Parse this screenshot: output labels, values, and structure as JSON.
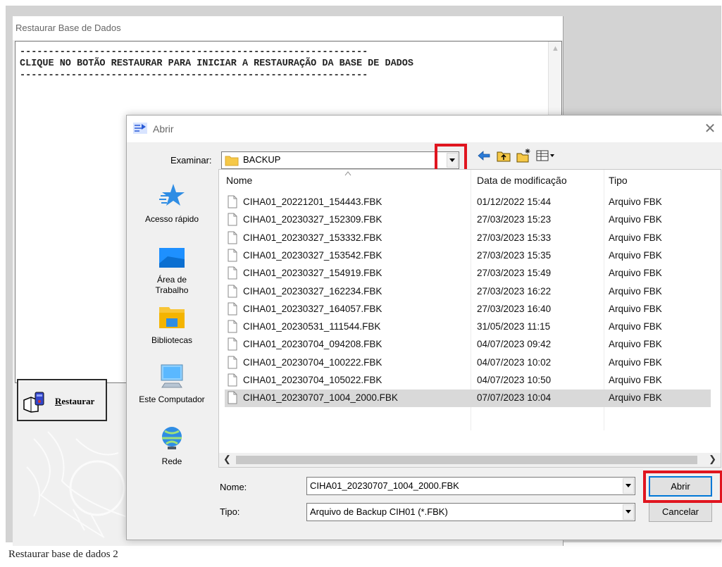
{
  "bg_window": {
    "title": "Restaurar Base de Dados",
    "memo_lines": [
      "-------------------------------------------------------------",
      "CLIQUE NO BOTÃO RESTAURAR PARA INICIAR A RESTAURAÇÃO DA BASE DE DADOS",
      "-------------------------------------------------------------"
    ],
    "restore_button": {
      "label_first": "R",
      "label_rest": "estaurar"
    }
  },
  "dialog": {
    "title": "Abrir",
    "close_glyph": "✕",
    "lookin_label": "Examinar:",
    "lookin_value": "BACKUP",
    "places": [
      {
        "label": "Acesso rápido",
        "icon": "quick-access-star-icon"
      },
      {
        "label": "Área de\nTrabalho",
        "icon": "desktop-icon"
      },
      {
        "label": "Bibliotecas",
        "icon": "libraries-icon"
      },
      {
        "label": "Este Computador",
        "icon": "computer-icon"
      },
      {
        "label": "Rede",
        "icon": "network-icon"
      }
    ],
    "columns": [
      "Nome",
      "Data de modificação",
      "Tipo"
    ],
    "files": [
      {
        "name": "CIHA01_20221201_154443.FBK",
        "date": "01/12/2022 15:44",
        "type": "Arquivo FBK"
      },
      {
        "name": "CIHA01_20230327_152309.FBK",
        "date": "27/03/2023 15:23",
        "type": "Arquivo FBK"
      },
      {
        "name": "CIHA01_20230327_153332.FBK",
        "date": "27/03/2023 15:33",
        "type": "Arquivo FBK"
      },
      {
        "name": "CIHA01_20230327_153542.FBK",
        "date": "27/03/2023 15:35",
        "type": "Arquivo FBK"
      },
      {
        "name": "CIHA01_20230327_154919.FBK",
        "date": "27/03/2023 15:49",
        "type": "Arquivo FBK"
      },
      {
        "name": "CIHA01_20230327_162234.FBK",
        "date": "27/03/2023 16:22",
        "type": "Arquivo FBK"
      },
      {
        "name": "CIHA01_20230327_164057.FBK",
        "date": "27/03/2023 16:40",
        "type": "Arquivo FBK"
      },
      {
        "name": "CIHA01_20230531_111544.FBK",
        "date": "31/05/2023 11:15",
        "type": "Arquivo FBK"
      },
      {
        "name": "CIHA01_20230704_094208.FBK",
        "date": "04/07/2023 09:42",
        "type": "Arquivo FBK"
      },
      {
        "name": "CIHA01_20230704_100222.FBK",
        "date": "04/07/2023 10:02",
        "type": "Arquivo FBK"
      },
      {
        "name": "CIHA01_20230704_105022.FBK",
        "date": "04/07/2023 10:50",
        "type": "Arquivo FBK"
      },
      {
        "name": "CIHA01_20230707_1004_2000.FBK",
        "date": "07/07/2023 10:04",
        "type": "Arquivo FBK",
        "selected": true
      }
    ],
    "filename_label": "Nome:",
    "filename_value": "CIHA01_20230707_1004_2000.FBK",
    "filetype_label": "Tipo:",
    "filetype_value": "Arquivo de Backup CIH01 (*.FBK)",
    "open_button": "Abrir",
    "cancel_button": "Cancelar"
  },
  "caption": "Restaurar base de dados 2",
  "highlight_color": "#e0151f"
}
